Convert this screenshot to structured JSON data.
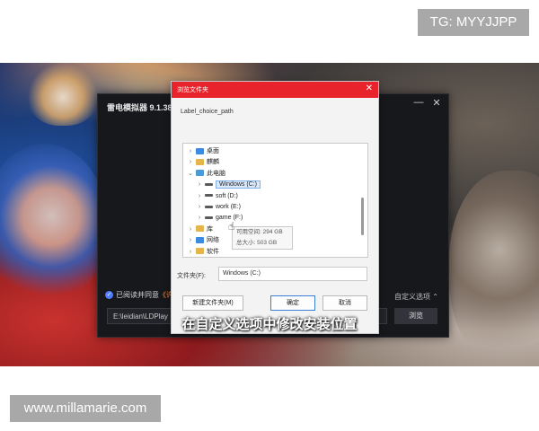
{
  "watermarks": {
    "tag": "TG: MYYJJPP",
    "site": "www.millamarie.com"
  },
  "installer": {
    "title": "雷电模拟器 9.1.38.2",
    "agree_text": "已阅读并同意",
    "agree_link": "《许",
    "custom_options": "自定义选项 ⌃",
    "install_path": "E:\\leidian\\LDPlay",
    "browse_label": "浏览",
    "controls": {
      "minimize": "—",
      "close": "✕"
    }
  },
  "dialog": {
    "title": "浏览文件夹",
    "close": "✕",
    "label": "Label_choice_path",
    "tree": [
      {
        "chevron": "›",
        "icon": "blue",
        "label": "桌面",
        "indent": 0
      },
      {
        "chevron": "›",
        "icon": "folder",
        "label": "麒麟",
        "indent": 0
      },
      {
        "chevron": "⌄",
        "icon": "pc",
        "label": "此电脑",
        "indent": 0
      },
      {
        "chevron": "›",
        "icon": "drive",
        "label": "Windows (C:)",
        "indent": 1,
        "selected": true
      },
      {
        "chevron": "›",
        "icon": "drive",
        "label": "soft (D:)",
        "indent": 1
      },
      {
        "chevron": "›",
        "icon": "drive",
        "label": "work (E:)",
        "indent": 1
      },
      {
        "chevron": "›",
        "icon": "drive",
        "label": "game (F:)",
        "indent": 1
      },
      {
        "chevron": "›",
        "icon": "folder",
        "label": "库",
        "indent": 0
      },
      {
        "chevron": "›",
        "icon": "blue",
        "label": "网络",
        "indent": 0
      },
      {
        "chevron": "›",
        "icon": "folder",
        "label": "软件",
        "indent": 0
      },
      {
        "chevron": "›",
        "icon": "folder",
        "label": "测试",
        "indent": 0
      }
    ],
    "tooltip": {
      "free": "可用空间: 294 GB",
      "total": "总大小: 503 GB"
    },
    "folder_label": "文件夹(F):",
    "folder_value": "Windows (C:)",
    "buttons": {
      "new_folder": "新建文件夹(M)",
      "ok": "确定",
      "cancel": "取消"
    }
  },
  "subtitle": "在自定义选项中修改安装位置"
}
